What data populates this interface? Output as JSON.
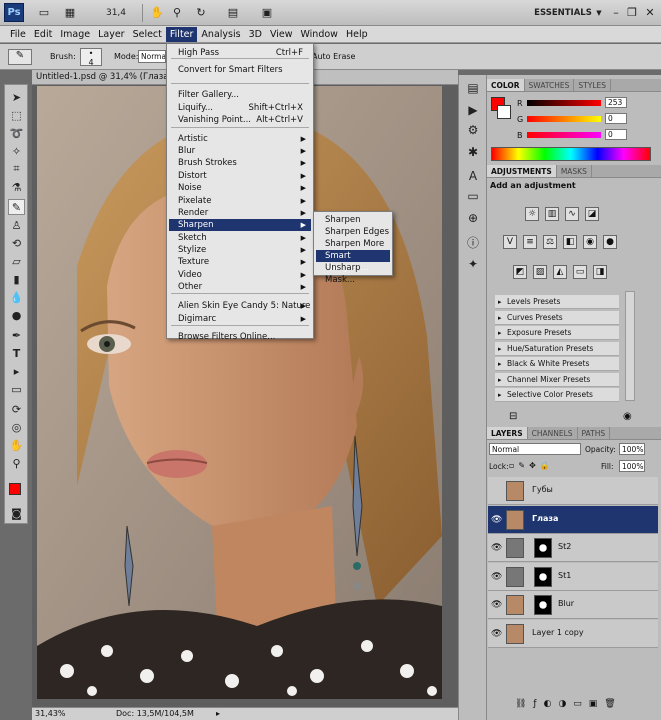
{
  "appbar": {
    "logo": "Ps",
    "zoom": "31,4",
    "workspace": "ESSENTIALS",
    "icons": [
      "file-icon",
      "minibridge-icon",
      "view-extras-icon",
      "hand-icon",
      "zoom-icon",
      "rotate-icon",
      "grid-icon",
      "arrange-icon",
      "screen-mode-icon",
      "workspace-dropdown-icon",
      "minimize-icon",
      "restore-icon",
      "close-icon"
    ]
  },
  "menubar": [
    "File",
    "Edit",
    "Image",
    "Layer",
    "Select",
    "Filter",
    "Analysis",
    "3D",
    "View",
    "Window",
    "Help"
  ],
  "options": {
    "brush_label": "Brush:",
    "brush_size": "4",
    "mode_label": "Mode:",
    "mode_value": "Normal",
    "auto_erase": "Auto Erase"
  },
  "document": {
    "tab_title": "Untitled-1.psd @ 31,4% (Глаза",
    "status_zoom": "31,43%",
    "status_doc": "Doc: 13,5M/104,5M"
  },
  "filter_menu": {
    "items": [
      {
        "label": "High Pass",
        "shortcut": "Ctrl+F"
      },
      {
        "label": "Convert for Smart Filters"
      },
      {
        "label": "Filter Gallery..."
      },
      {
        "label": "Liquify...",
        "shortcut": "Shift+Ctrl+X"
      },
      {
        "label": "Vanishing Point...",
        "shortcut": "Alt+Ctrl+V"
      },
      {
        "label": "Artistic",
        "submenu": true
      },
      {
        "label": "Blur",
        "submenu": true
      },
      {
        "label": "Brush Strokes",
        "submenu": true
      },
      {
        "label": "Distort",
        "submenu": true
      },
      {
        "label": "Noise",
        "submenu": true
      },
      {
        "label": "Pixelate",
        "submenu": true
      },
      {
        "label": "Render",
        "submenu": true
      },
      {
        "label": "Sharpen",
        "submenu": true
      },
      {
        "label": "Sketch",
        "submenu": true
      },
      {
        "label": "Stylize",
        "submenu": true
      },
      {
        "label": "Texture",
        "submenu": true
      },
      {
        "label": "Video",
        "submenu": true
      },
      {
        "label": "Other",
        "submenu": true
      },
      {
        "label": "Alien Skin Eye Candy 5: Nature",
        "submenu": true
      },
      {
        "label": "Digimarc",
        "submenu": true
      },
      {
        "label": "Browse Filters Online..."
      }
    ]
  },
  "sharpen_submenu": {
    "items": [
      "Sharpen",
      "Sharpen Edges",
      "Sharpen More",
      "Smart Sharpen...",
      "Unsharp Mask..."
    ],
    "highlighted": "Smart Sharpen..."
  },
  "color_panel": {
    "tabs": [
      "COLOR",
      "SWATCHES",
      "STYLES"
    ],
    "r_label": "R",
    "g_label": "G",
    "b_label": "B",
    "r": "253",
    "g": "0",
    "b": "0",
    "foreground": "#fd0000",
    "background": "#ffffff"
  },
  "adjustments_panel": {
    "tabs": [
      "ADJUSTMENTS",
      "MASKS"
    ],
    "heading": "Add an adjustment",
    "presets": [
      "Levels Presets",
      "Curves Presets",
      "Exposure Presets",
      "Hue/Saturation Presets",
      "Black & White Presets",
      "Channel Mixer Presets",
      "Selective Color Presets"
    ]
  },
  "layers_panel": {
    "tabs": [
      "LAYERS",
      "CHANNELS",
      "PATHS"
    ],
    "blend_mode": "Normal",
    "opacity_label": "Opacity:",
    "opacity": "100%",
    "lock_label": "Lock:",
    "fill_label": "Fill:",
    "fill": "100%",
    "layers": [
      {
        "name": "Губы",
        "visible": false,
        "selected": false
      },
      {
        "name": "Глаза",
        "visible": true,
        "selected": true
      },
      {
        "name": "St2",
        "visible": true,
        "selected": false
      },
      {
        "name": "St1",
        "visible": true,
        "selected": false
      },
      {
        "name": "Blur",
        "visible": true,
        "selected": false
      },
      {
        "name": "Layer 1 copy",
        "visible": true,
        "selected": false
      }
    ]
  }
}
